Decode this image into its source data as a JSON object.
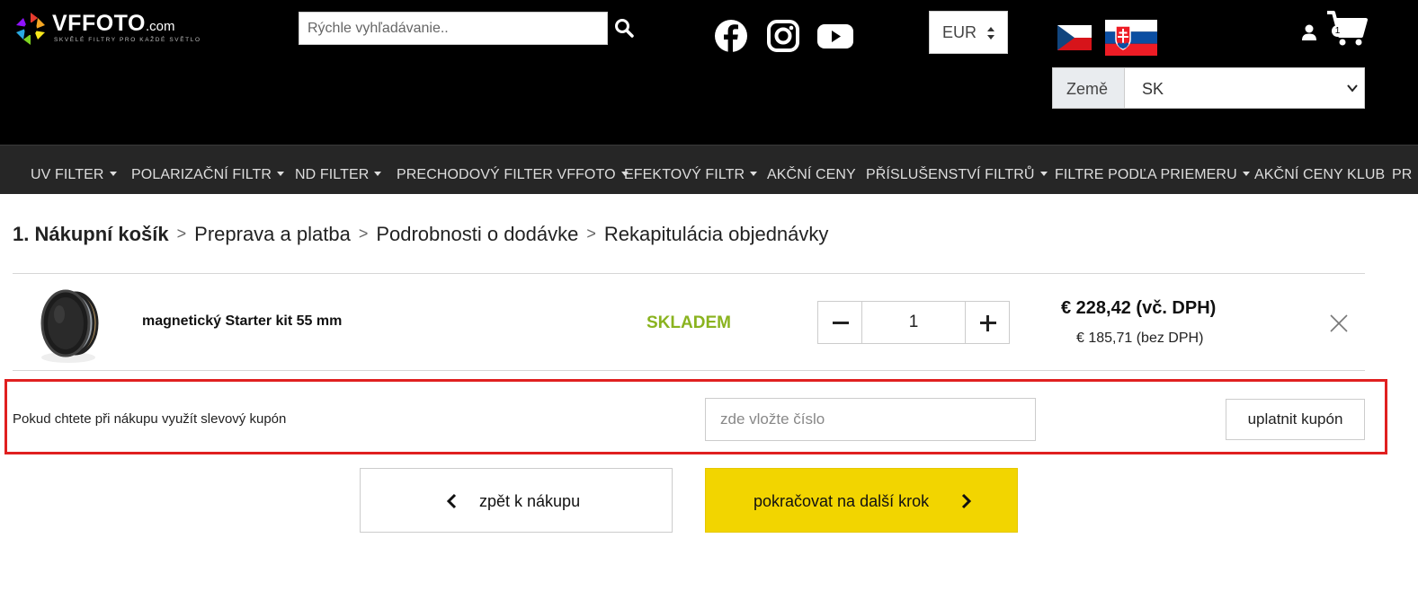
{
  "header": {
    "logo_text": "VFFOTO",
    "logo_suffix": ".com",
    "logo_tagline": "SKVĚLÉ FILTRY PRO KAŽDÉ SVĚTLO",
    "search_placeholder": "Rýchle vyhľadávanie..",
    "currency": "EUR",
    "country_label": "Země",
    "country_value": "SK",
    "cart_count": "1",
    "icons": [
      "search-icon",
      "facebook-icon",
      "instagram-icon",
      "youtube-icon",
      "user-icon",
      "cart-icon"
    ]
  },
  "nav": {
    "items": [
      {
        "label": "UV FILTER",
        "dropdown": true
      },
      {
        "label": "POLARIZAČNÍ FILTR",
        "dropdown": true
      },
      {
        "label": "ND FILTER",
        "dropdown": true
      },
      {
        "label": "PRECHODOVÝ FILTER VFFOTO",
        "dropdown": true
      },
      {
        "label": "EFEKTOVÝ FILTR",
        "dropdown": true
      },
      {
        "label": "AKČNÍ CENY",
        "dropdown": false
      },
      {
        "label": "PŘÍSLUŠENSTVÍ FILTRŮ",
        "dropdown": true
      },
      {
        "label": "FILTRE PODĽA PRIEMERU",
        "dropdown": true
      },
      {
        "label": "AKČNÍ CENY KLUB",
        "dropdown": false
      },
      {
        "label": "PR",
        "dropdown": false
      }
    ]
  },
  "steps": [
    {
      "label": "1. Nákupní košík",
      "active": true
    },
    {
      "label": "Preprava a platba",
      "active": false
    },
    {
      "label": "Podrobnosti o dodávke",
      "active": false
    },
    {
      "label": "Rekapitulácia objednávky",
      "active": false
    }
  ],
  "step_separator": ">",
  "cart": {
    "item_name": "magnetický Starter kit 55 mm",
    "stock": "SKLADEM",
    "quantity": "1",
    "price_vat": "€ 228,42 (vč. DPH)",
    "price_novat": "€ 185,71 (bez DPH)"
  },
  "coupon": {
    "label": "Pokud chtete při nákupu využít slevový kupón",
    "placeholder": "zde vložte číslo",
    "button": "uplatnit kupón"
  },
  "actions": {
    "back": "zpět k nákupu",
    "next": "pokračovat na další krok"
  },
  "colors": {
    "header_bg": "#000000",
    "nav_bg": "#262626",
    "stock_green": "#8ab31f",
    "next_yellow": "#f2d500",
    "highlight_red": "#e02020"
  }
}
